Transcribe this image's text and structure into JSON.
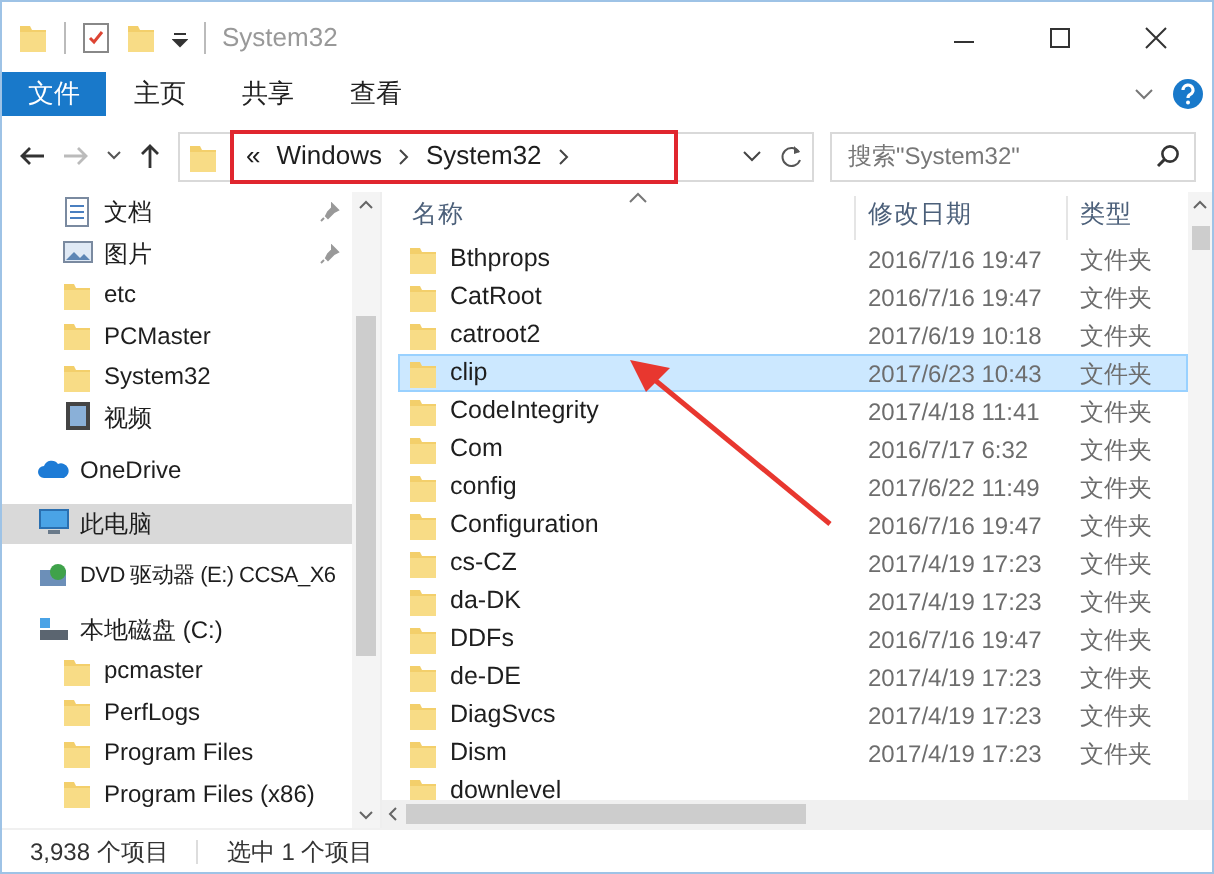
{
  "window": {
    "title": "System32"
  },
  "ribbon": {
    "tabs": [
      {
        "label": "文件",
        "selected": true
      },
      {
        "label": "主页",
        "selected": false
      },
      {
        "label": "共享",
        "selected": false
      },
      {
        "label": "查看",
        "selected": false
      }
    ]
  },
  "address": {
    "overflow": "«",
    "crumbs": [
      "Windows",
      "System32"
    ],
    "highlighted": true
  },
  "search": {
    "placeholder": "搜索\"System32\""
  },
  "sidebar": {
    "items": [
      {
        "label": "文档",
        "kind": "document",
        "pinned": true,
        "selected": false
      },
      {
        "label": "图片",
        "kind": "picture",
        "pinned": true,
        "selected": false
      },
      {
        "label": "etc",
        "kind": "folder",
        "pinned": false,
        "selected": false
      },
      {
        "label": "PCMaster",
        "kind": "folder",
        "pinned": false,
        "selected": false
      },
      {
        "label": "System32",
        "kind": "folder",
        "pinned": false,
        "selected": false
      },
      {
        "label": "视频",
        "kind": "video",
        "pinned": false,
        "selected": false
      },
      {
        "label": "OneDrive",
        "kind": "cloud",
        "pinned": false,
        "selected": false
      },
      {
        "label": "此电脑",
        "kind": "computer",
        "pinned": false,
        "selected": true
      },
      {
        "label": "DVD 驱动器 (E:) CCSA_X6",
        "kind": "dvd",
        "pinned": false,
        "selected": false
      },
      {
        "label": "本地磁盘 (C:)",
        "kind": "disk",
        "pinned": false,
        "selected": false
      },
      {
        "label": "pcmaster",
        "kind": "folder",
        "pinned": false,
        "selected": false
      },
      {
        "label": "PerfLogs",
        "kind": "folder",
        "pinned": false,
        "selected": false
      },
      {
        "label": "Program Files",
        "kind": "folder",
        "pinned": false,
        "selected": false
      },
      {
        "label": "Program Files (x86)",
        "kind": "folder",
        "pinned": false,
        "selected": false
      }
    ]
  },
  "table": {
    "columns": [
      "名称",
      "修改日期",
      "类型"
    ],
    "rows": [
      {
        "name": "Bthprops",
        "date": "2016/7/16 19:47",
        "type": "文件夹",
        "selected": false
      },
      {
        "name": "CatRoot",
        "date": "2016/7/16 19:47",
        "type": "文件夹",
        "selected": false
      },
      {
        "name": "catroot2",
        "date": "2017/6/19 10:18",
        "type": "文件夹",
        "selected": false
      },
      {
        "name": "clip",
        "date": "2017/6/23 10:43",
        "type": "文件夹",
        "selected": true
      },
      {
        "name": "CodeIntegrity",
        "date": "2017/4/18 11:41",
        "type": "文件夹",
        "selected": false
      },
      {
        "name": "Com",
        "date": "2016/7/17 6:32",
        "type": "文件夹",
        "selected": false
      },
      {
        "name": "config",
        "date": "2017/6/22 11:49",
        "type": "文件夹",
        "selected": false
      },
      {
        "name": "Configuration",
        "date": "2016/7/16 19:47",
        "type": "文件夹",
        "selected": false
      },
      {
        "name": "cs-CZ",
        "date": "2017/4/19 17:23",
        "type": "文件夹",
        "selected": false
      },
      {
        "name": "da-DK",
        "date": "2017/4/19 17:23",
        "type": "文件夹",
        "selected": false
      },
      {
        "name": "DDFs",
        "date": "2016/7/16 19:47",
        "type": "文件夹",
        "selected": false
      },
      {
        "name": "de-DE",
        "date": "2017/4/19 17:23",
        "type": "文件夹",
        "selected": false
      },
      {
        "name": "DiagSvcs",
        "date": "2017/4/19 17:23",
        "type": "文件夹",
        "selected": false
      },
      {
        "name": "Dism",
        "date": "2017/4/19 17:23",
        "type": "文件夹",
        "selected": false
      },
      {
        "name": "downlevel",
        "selected": false
      }
    ]
  },
  "annotation": {
    "arrow": true
  },
  "status_bar": {
    "count": "3,938 个项目",
    "selection": "选中 1 个项目"
  }
}
